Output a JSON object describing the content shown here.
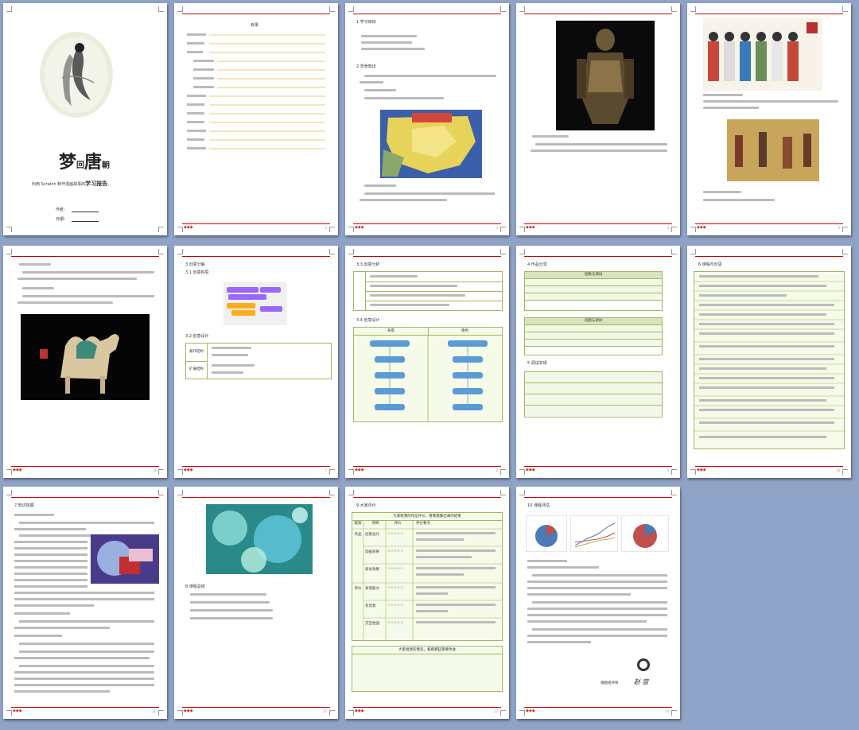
{
  "cover": {
    "title_big_1": "梦",
    "title_small": "回",
    "title_big_2": "唐",
    "title_tail": "朝",
    "subtitle_prefix": "利用 Scratch 制作漫画故事的",
    "subtitle_main": "学习报告",
    "subtitle_suffix": "。",
    "author_label": "作者：",
    "date_label": "日期："
  },
  "toc": {
    "title": "目录"
  },
  "sections": {
    "p3_s1": "1 学习目标",
    "p3_s2": "2 背景知识",
    "p7_s3": "3 创意分解",
    "p7_s31": "3.1 创意构思",
    "p7_s32": "3.2 创意设计",
    "p7_t1": "著作结构",
    "p7_t2": "扩展结构",
    "p8_s33": "3.3 创意分析",
    "p8_s34": "3.4 创意设计",
    "p8_col1": "背景",
    "p8_col2": "角色",
    "p9_s4": "4 作品分享",
    "p9_box1": "思路与调试",
    "p9_box2": "问题与调试",
    "p9_s5": "5 调试实现",
    "p10_s6": "6 课程与反思",
    "p11_s7": "7 知识拓展",
    "p12_s8": "8 课程总结",
    "p13_s9": "9 大家评价",
    "p13_table_title": "大家给我的作品评价，看看我做出来的结果",
    "p13_h1": "类别",
    "p13_h2": "项目",
    "p13_h3": "评价",
    "p13_h4": "评价要点",
    "p13_row_group1": "作品",
    "p13_row_group2": "评价",
    "p13_r1": "创意设计",
    "p13_r2": "动画效果",
    "p13_r3": "表达效果",
    "p13_r4": "表现能力",
    "p13_r5": "有创意",
    "p13_r6": "交互性强",
    "p13_stars": "☆☆☆☆☆",
    "p13_box2": "大家给我的建议，看看哪些需要改进",
    "p14_s10": "10 课程评估",
    "p14_sign_label": "课题组评审",
    "p14_sign": "赵 宫"
  },
  "page_numbers": [
    "1",
    "2",
    "3",
    "4",
    "5",
    "6",
    "7",
    "8",
    "9",
    "10",
    "11",
    "12",
    "13",
    "14"
  ],
  "colors": {
    "background": "#8fa3c7",
    "accent_red": "#cc0000",
    "table_green": "#9bbb59",
    "flow_blue": "#5b9bd5"
  }
}
